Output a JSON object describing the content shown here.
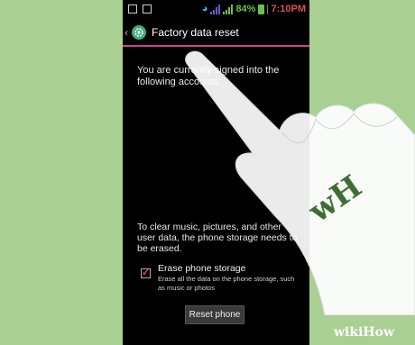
{
  "status_bar": {
    "battery": "84%",
    "time": "7:10PM",
    "icons": [
      "image-icon",
      "notification-icon",
      "wifi-icon",
      "signal-icon",
      "signal-icon",
      "battery-icon"
    ]
  },
  "action_bar": {
    "title": "Factory data reset",
    "icon": "settings-icon",
    "accent": "#d0408a"
  },
  "accounts_text": "You are currently signed into the following accounts:",
  "clear_text": "To clear music, pictures, and other user data, the phone storage needs to be erased.",
  "erase_option": {
    "label": "Erase phone storage",
    "description": "Erase all the data on the phone storage, such as music or photos",
    "checked": true
  },
  "reset_button": "Reset phone",
  "watermark": {
    "wiki": "wiki",
    "how": "How",
    "logo_letters": "wH"
  }
}
